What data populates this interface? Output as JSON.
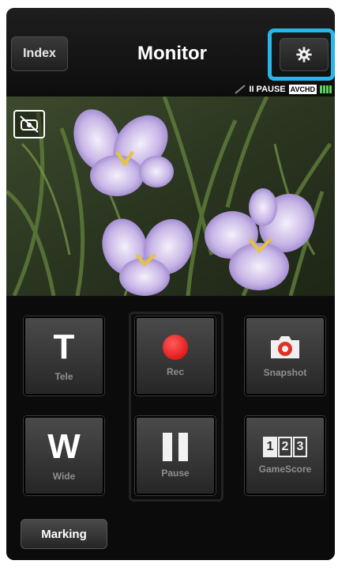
{
  "header": {
    "index_label": "Index",
    "title": "Monitor",
    "settings_icon": "gear-icon"
  },
  "status": {
    "pause_text": "II PAUSE",
    "format_badge": "AVCHD",
    "battery_level": 1.0
  },
  "preview": {
    "camera_off_icon": "camera-off-icon"
  },
  "controls": {
    "tele": {
      "glyph": "T",
      "label": "Tele"
    },
    "rec": {
      "label": "Rec"
    },
    "snapshot": {
      "label": "Snapshot"
    },
    "wide": {
      "glyph": "W",
      "label": "Wide"
    },
    "pause": {
      "label": "Pause"
    },
    "gamescore": {
      "digits": [
        "1",
        "2",
        "3"
      ],
      "label": "GameScore"
    },
    "marking_label": "Marking"
  },
  "colors": {
    "highlight": "#29b6e8",
    "record": "#e01010",
    "battery": "#5fd35f"
  }
}
